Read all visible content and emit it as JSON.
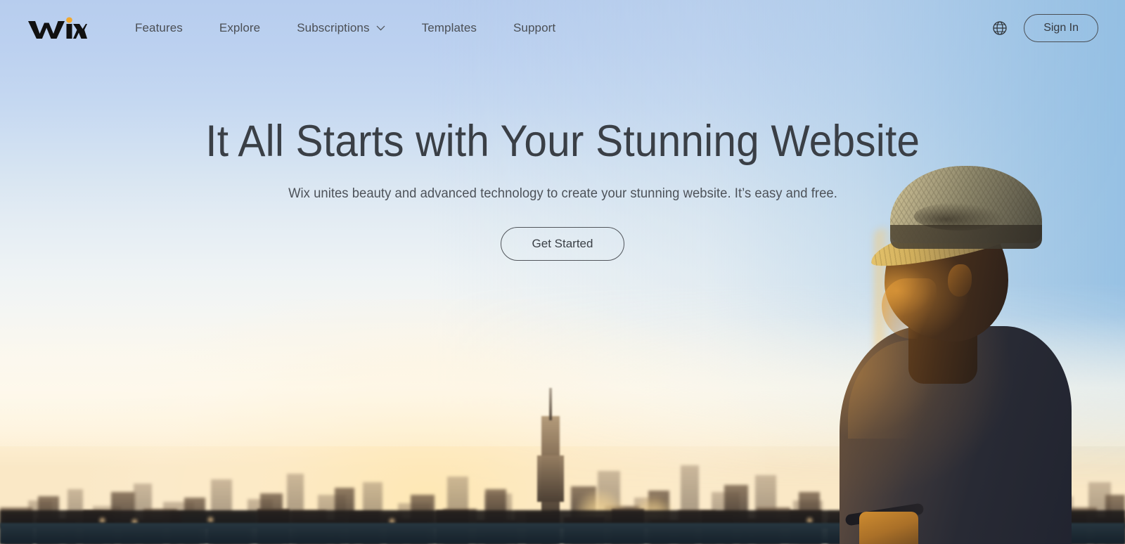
{
  "site": {
    "brand": "WiX",
    "brand_accent_color": "#f0a830",
    "logo_color": "#111111"
  },
  "header": {
    "nav": [
      {
        "label": "Features",
        "has_dropdown": false,
        "icon": ""
      },
      {
        "label": "Explore",
        "has_dropdown": false,
        "icon": ""
      },
      {
        "label": "Subscriptions",
        "has_dropdown": true,
        "icon": "chevron-down-icon"
      },
      {
        "label": "Templates",
        "has_dropdown": false,
        "icon": ""
      },
      {
        "label": "Support",
        "has_dropdown": false,
        "icon": ""
      }
    ],
    "language_icon": "globe-icon",
    "sign_in_label": "Sign In",
    "nav_text_color": "#4b4f55"
  },
  "hero": {
    "headline": "It All Starts with Your Stunning Website",
    "subhead": "Wix unites beauty and advanced technology to create your stunning website. It’s easy and free.",
    "cta_label": "Get Started",
    "text_color": "#3a3f46"
  },
  "background": {
    "description": "Sunset photo of a man in a straw fedora looking out over the New York City skyline",
    "sky_top_color": "#b7cdee",
    "sky_mid_color": "#eef3f5",
    "sky_horizon_color": "#fae8c6",
    "sky_right_blue": "#92bee2",
    "skyline_color": "#2a231e",
    "water_color": "#1e2c36",
    "subject": "man-in-straw-hat",
    "landmark": "Empire State Building"
  }
}
